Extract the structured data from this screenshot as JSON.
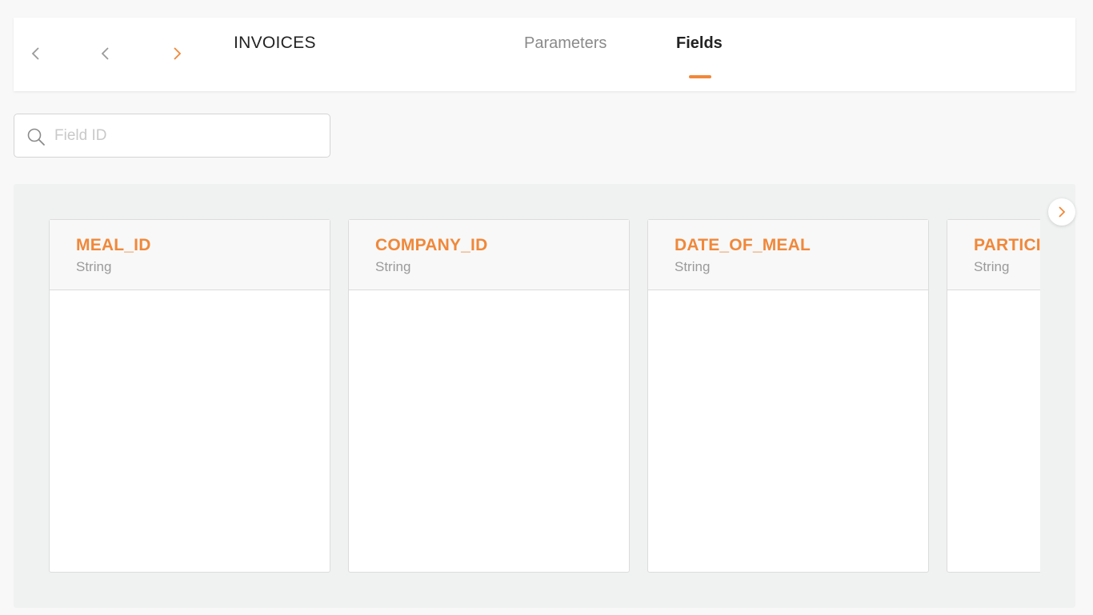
{
  "header": {
    "title": "INVOICES",
    "tabs": [
      {
        "label": "Parameters",
        "active": false
      },
      {
        "label": "Fields",
        "active": true
      }
    ]
  },
  "nav_icons": [
    "chevron-left-icon",
    "chevron-left-icon",
    "chevron-right-icon"
  ],
  "search": {
    "placeholder": "Field ID",
    "value": ""
  },
  "fields": [
    {
      "name": "MEAL_ID",
      "type": "String"
    },
    {
      "name": "COMPANY_ID",
      "type": "String"
    },
    {
      "name": "DATE_OF_MEAL",
      "type": "String"
    },
    {
      "name": "PARTICI",
      "type": "String"
    }
  ],
  "colors": {
    "accent": "#f0883a",
    "text_dark": "#222222",
    "text_muted": "#9a9a9a",
    "panel_bg": "#f0f1f1"
  }
}
